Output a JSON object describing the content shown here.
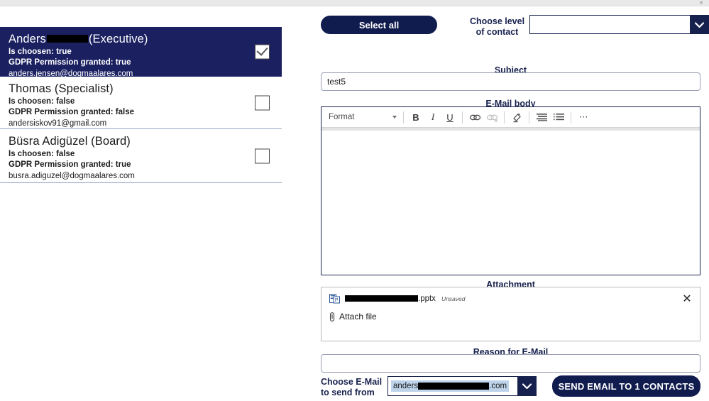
{
  "window": {
    "close_label": "×"
  },
  "contacts": {
    "items": [
      {
        "name_prefix": "Anders",
        "name_suffix": "(Executive)",
        "redacted": true,
        "chosen_label": "Is choosen: true",
        "gdpr_label": "GDPR Permission granted: true",
        "email": "anders.jensen@dogmaalares.com",
        "selected": true,
        "checked": true
      },
      {
        "name_prefix": "Thomas (Specialist)",
        "name_suffix": "",
        "redacted": false,
        "chosen_label": "Is choosen: false",
        "gdpr_label": "GDPR Permission granted: false",
        "email": "andersiskov91@gmail.com",
        "selected": false,
        "checked": false
      },
      {
        "name_prefix": "Büsra Adigüzel (Board)",
        "name_suffix": "",
        "redacted": false,
        "chosen_label": "Is choosen: false",
        "gdpr_label": "GDPR Permission granted: true",
        "email": "busra.adiguzel@dogmaalares.com",
        "selected": false,
        "checked": false
      }
    ]
  },
  "toolbar": {
    "select_all_label": "Select all",
    "level_label_line1": "Choose level",
    "level_label_line2": "of contact",
    "level_value": ""
  },
  "subject": {
    "label": "Subject",
    "value": "test5",
    "placeholder": ""
  },
  "body": {
    "label": "E-Mail body",
    "format_label": "Format",
    "buttons": {
      "bold": "B",
      "italic": "I",
      "underline": "U",
      "overflow": "⋯"
    },
    "content": ""
  },
  "attachment": {
    "label": "Attachment",
    "file_extension": ".pptx",
    "file_status": "Unsaved",
    "attach_file_label": "Attach file",
    "remove_label": "✕"
  },
  "reason": {
    "label": "Reason for E-Mail",
    "value": "",
    "placeholder": ""
  },
  "from": {
    "label_line1": "Choose E-Mail",
    "label_line2": "to send from",
    "value_prefix": "anders",
    "value_suffix": ".com"
  },
  "send": {
    "label": "SEND EMAIL TO 1 CONTACTS"
  },
  "colors": {
    "navy": "#17214d",
    "navy_button": "#111c4e",
    "selected_row": "#1a2060",
    "selection_highlight": "#bdd3ea"
  }
}
